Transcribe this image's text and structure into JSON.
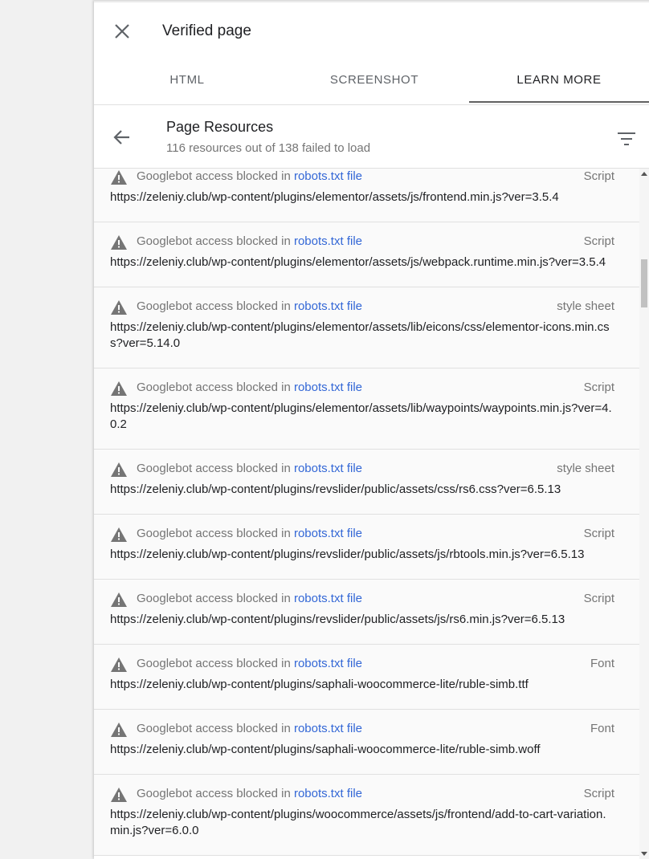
{
  "header": {
    "title": "Verified page"
  },
  "tabs": [
    {
      "label": "HTML"
    },
    {
      "label": "SCREENSHOT"
    },
    {
      "label": "LEARN MORE",
      "active": true
    }
  ],
  "subheader": {
    "title": "Page Resources",
    "description": "116 resources out of 138 failed to load"
  },
  "colors": {
    "link": "#3367d6",
    "accent_underline": "#616161",
    "muted_text": "#757575"
  },
  "resources": [
    {
      "message": "Googlebot access blocked in ",
      "link": "robots.txt file",
      "type": "Script",
      "url": "https://zeleniy.club/wp-content/plugins/elementor/assets/js/frontend.min.js?ver=3.5.4"
    },
    {
      "message": "Googlebot access blocked in ",
      "link": "robots.txt file",
      "type": "Script",
      "url": "https://zeleniy.club/wp-content/plugins/elementor/assets/js/webpack.runtime.min.js?ver=3.5.4"
    },
    {
      "message": "Googlebot access blocked in ",
      "link": "robots.txt file",
      "type": "style sheet",
      "url": "https://zeleniy.club/wp-content/plugins/elementor/assets/lib/eicons/css/elementor-icons.min.css?ver=5.14.0"
    },
    {
      "message": "Googlebot access blocked in ",
      "link": "robots.txt file",
      "type": "Script",
      "url": "https://zeleniy.club/wp-content/plugins/elementor/assets/lib/waypoints/waypoints.min.js?ver=4.0.2"
    },
    {
      "message": "Googlebot access blocked in ",
      "link": "robots.txt file",
      "type": "style sheet",
      "url": "https://zeleniy.club/wp-content/plugins/revslider/public/assets/css/rs6.css?ver=6.5.13"
    },
    {
      "message": "Googlebot access blocked in ",
      "link": "robots.txt file",
      "type": "Script",
      "url": "https://zeleniy.club/wp-content/plugins/revslider/public/assets/js/rbtools.min.js?ver=6.5.13"
    },
    {
      "message": "Googlebot access blocked in ",
      "link": "robots.txt file",
      "type": "Script",
      "url": "https://zeleniy.club/wp-content/plugins/revslider/public/assets/js/rs6.min.js?ver=6.5.13"
    },
    {
      "message": "Googlebot access blocked in ",
      "link": "robots.txt file",
      "type": "Font",
      "url": "https://zeleniy.club/wp-content/plugins/saphali-woocommerce-lite/ruble-simb.ttf"
    },
    {
      "message": "Googlebot access blocked in ",
      "link": "robots.txt file",
      "type": "Font",
      "url": "https://zeleniy.club/wp-content/plugins/saphali-woocommerce-lite/ruble-simb.woff"
    },
    {
      "message": "Googlebot access blocked in ",
      "link": "robots.txt file",
      "type": "Script",
      "url": "https://zeleniy.club/wp-content/plugins/woocommerce/assets/js/frontend/add-to-cart-variation.min.js?ver=6.0.0"
    }
  ]
}
